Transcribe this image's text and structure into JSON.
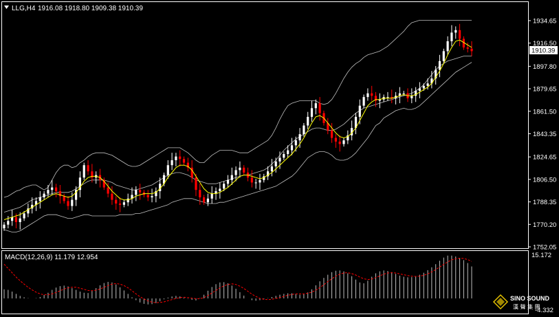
{
  "header": {
    "arrow_icon": "triangle-down-icon",
    "symbol": "LLG,H4",
    "ohlc": "1916.08 1918.80 1909.38 1910.39"
  },
  "price_axis": {
    "ticks": [
      "1934.65",
      "1916.50",
      "1897.80",
      "1879.65",
      "1861.50",
      "1843.35",
      "1824.65",
      "1806.50",
      "1788.35",
      "1770.20",
      "1752.05"
    ],
    "current_price_label": "1910.39"
  },
  "macd_panel": {
    "title": "MACD(12,26,9) 11.179 12.954",
    "top_label": "15.172",
    "bottom_label": "-4.332"
  },
  "watermark": {
    "brand": "SINO SOUND",
    "sub": "漢 聲 集 團",
    "icon": "diamond-logo-icon"
  },
  "colors": {
    "background": "#000000",
    "bull_candle": "#ffffff",
    "bear_candle": "#ff0000",
    "bollinger": "#c0c0c0",
    "ma_line": "#ffff00",
    "macd_hist": "#c0c0c0",
    "macd_signal": "#ff0000"
  },
  "chart_data": [
    {
      "type": "candlestick",
      "title": "LLG,H4",
      "ylim": [
        1752.05,
        1934.65
      ],
      "ticks": [
        1934.65,
        1916.5,
        1897.8,
        1879.65,
        1861.5,
        1843.35,
        1824.65,
        1806.5,
        1788.35,
        1770.2,
        1752.05
      ],
      "last_close": 1910.39,
      "close": [
        1770,
        1773,
        1776,
        1772,
        1775,
        1779,
        1783,
        1786,
        1789,
        1792,
        1795,
        1798,
        1800,
        1797,
        1793,
        1789,
        1785,
        1790,
        1798,
        1808,
        1818,
        1813,
        1808,
        1810,
        1806,
        1800,
        1795,
        1790,
        1787,
        1786,
        1788,
        1791,
        1794,
        1798,
        1796,
        1794,
        1792,
        1793,
        1797,
        1803,
        1810,
        1818,
        1822,
        1825,
        1823,
        1820,
        1816,
        1808,
        1798,
        1792,
        1788,
        1791,
        1795,
        1797,
        1799,
        1803,
        1806,
        1810,
        1814,
        1816,
        1812,
        1808,
        1804,
        1804,
        1806,
        1809,
        1813,
        1817,
        1821,
        1824,
        1827,
        1830,
        1834,
        1838,
        1843,
        1850,
        1857,
        1864,
        1868,
        1860,
        1852,
        1846,
        1840,
        1837,
        1835,
        1838,
        1842,
        1848,
        1857,
        1866,
        1873,
        1876,
        1874,
        1870,
        1871,
        1873,
        1873,
        1872,
        1874,
        1876,
        1876,
        1872,
        1874,
        1878,
        1880,
        1882,
        1884,
        1888,
        1895,
        1902,
        1910,
        1918,
        1925,
        1927,
        1920,
        1913,
        1912,
        1910
      ],
      "bollinger_upper": [
        1792,
        1793,
        1795,
        1797,
        1798,
        1800,
        1801,
        1802,
        1802,
        1800,
        1798,
        1800,
        1806,
        1812,
        1816,
        1818,
        1818,
        1816,
        1817,
        1820,
        1822,
        1825,
        1827,
        1828,
        1828,
        1828,
        1827,
        1826,
        1824,
        1822,
        1820,
        1818,
        1817,
        1817,
        1818,
        1820,
        1822,
        1824,
        1826,
        1828,
        1830,
        1832,
        1832,
        1832,
        1832,
        1830,
        1828,
        1825,
        1822,
        1820,
        1820,
        1823,
        1826,
        1828,
        1830,
        1830,
        1830,
        1830,
        1829,
        1828,
        1828,
        1828,
        1830,
        1832,
        1834,
        1836,
        1838,
        1842,
        1848,
        1855,
        1861,
        1866,
        1868,
        1869,
        1870,
        1870,
        1870,
        1870,
        1870,
        1868,
        1867,
        1868,
        1871,
        1876,
        1882,
        1888,
        1893,
        1897,
        1900,
        1902,
        1905,
        1907,
        1908,
        1909,
        1910,
        1912,
        1914,
        1917,
        1920,
        1923,
        1926,
        1930,
        1933,
        1934,
        1935,
        1935,
        1935,
        1935,
        1935,
        1935,
        1935,
        1935,
        1935,
        1935,
        1935,
        1935,
        1935,
        1935
      ],
      "bollinger_middle": [
        1780,
        1781,
        1782,
        1783,
        1784,
        1786,
        1788,
        1790,
        1791,
        1792,
        1793,
        1794,
        1795,
        1796,
        1796,
        1796,
        1796,
        1797,
        1799,
        1801,
        1803,
        1805,
        1806,
        1806,
        1806,
        1806,
        1805,
        1804,
        1802,
        1801,
        1800,
        1799,
        1798,
        1798,
        1799,
        1800,
        1801,
        1802,
        1804,
        1806,
        1808,
        1810,
        1811,
        1812,
        1812,
        1811,
        1810,
        1808,
        1806,
        1805,
        1804,
        1803,
        1803,
        1803,
        1804,
        1805,
        1806,
        1807,
        1808,
        1809,
        1810,
        1810,
        1811,
        1812,
        1813,
        1814,
        1816,
        1819,
        1822,
        1826,
        1830,
        1833,
        1836,
        1839,
        1841,
        1843,
        1845,
        1847,
        1848,
        1848,
        1847,
        1846,
        1846,
        1847,
        1849,
        1851,
        1854,
        1857,
        1860,
        1862,
        1864,
        1865,
        1866,
        1867,
        1868,
        1869,
        1870,
        1871,
        1872,
        1873,
        1874,
        1875,
        1876,
        1878,
        1880,
        1883,
        1887,
        1891,
        1895,
        1898,
        1900,
        1902,
        1903,
        1904,
        1905,
        1906,
        1906,
        1906
      ],
      "bollinger_lower": [
        1766,
        1765,
        1764,
        1764,
        1765,
        1767,
        1769,
        1771,
        1773,
        1775,
        1777,
        1778,
        1778,
        1778,
        1777,
        1776,
        1775,
        1775,
        1776,
        1777,
        1778,
        1778,
        1777,
        1777,
        1777,
        1777,
        1777,
        1777,
        1777,
        1778,
        1778,
        1778,
        1778,
        1779,
        1779,
        1780,
        1781,
        1782,
        1783,
        1784,
        1785,
        1786,
        1788,
        1789,
        1790,
        1791,
        1791,
        1791,
        1790,
        1789,
        1788,
        1787,
        1787,
        1787,
        1788,
        1788,
        1789,
        1790,
        1791,
        1792,
        1793,
        1794,
        1795,
        1796,
        1797,
        1798,
        1799,
        1800,
        1801,
        1803,
        1805,
        1807,
        1809,
        1812,
        1816,
        1820,
        1824,
        1826,
        1828,
        1829,
        1829,
        1828,
        1826,
        1823,
        1822,
        1822,
        1823,
        1825,
        1828,
        1832,
        1836,
        1840,
        1845,
        1850,
        1852,
        1856,
        1858,
        1860,
        1862,
        1863,
        1864,
        1863,
        1863,
        1864,
        1866,
        1869,
        1872,
        1875,
        1878,
        1881,
        1884,
        1887,
        1890,
        1893,
        1895,
        1897,
        1899,
        1901
      ],
      "ma": [
        1774,
        1775,
        1776,
        1777,
        1778,
        1780,
        1782,
        1784,
        1786,
        1788,
        1790,
        1792,
        1794,
        1795,
        1794,
        1793,
        1792,
        1793,
        1796,
        1800,
        1805,
        1808,
        1809,
        1809,
        1808,
        1805,
        1801,
        1797,
        1794,
        1791,
        1790,
        1790,
        1791,
        1793,
        1794,
        1795,
        1795,
        1795,
        1796,
        1799,
        1803,
        1808,
        1812,
        1816,
        1818,
        1818,
        1817,
        1814,
        1809,
        1804,
        1799,
        1796,
        1795,
        1795,
        1796,
        1798,
        1800,
        1803,
        1806,
        1809,
        1810,
        1810,
        1809,
        1808,
        1807,
        1808,
        1810,
        1812,
        1815,
        1818,
        1821,
        1824,
        1827,
        1831,
        1835,
        1840,
        1846,
        1852,
        1857,
        1858,
        1856,
        1852,
        1848,
        1844,
        1841,
        1840,
        1841,
        1844,
        1848,
        1854,
        1860,
        1866,
        1869,
        1871,
        1871,
        1872,
        1872,
        1872,
        1873,
        1874,
        1875,
        1874,
        1874,
        1875,
        1877,
        1879,
        1881,
        1884,
        1889,
        1894,
        1900,
        1907,
        1913,
        1918,
        1919,
        1917,
        1915,
        1913
      ]
    },
    {
      "type": "bar",
      "title": "MACD(12,26,9)",
      "series": [
        {
          "name": "MACD",
          "values": [
            3.2,
            3.0,
            2.4,
            1.6,
            0.9,
            0.4,
            0.1,
            0.0,
            0.1,
            0.5,
            1.2,
            2.0,
            3.0,
            3.8,
            4.3,
            4.5,
            4.2,
            3.6,
            3.0,
            2.4,
            2.0,
            1.9,
            2.6,
            3.6,
            4.6,
            5.4,
            5.8,
            5.6,
            4.9,
            3.9,
            2.8,
            1.6,
            0.4,
            -0.6,
            -1.4,
            -1.9,
            -2.1,
            -2.0,
            -1.6,
            -1.0,
            -0.3,
            0.3,
            0.7,
            0.9,
            0.7,
            0.3,
            -0.1,
            -0.5,
            -0.7,
            0.1,
            1.3,
            2.7,
            4.0,
            5.0,
            5.6,
            5.7,
            5.3,
            4.5,
            3.4,
            2.2,
            1.0,
            0.0,
            -0.6,
            -0.8,
            -0.6,
            -0.3,
            0.1,
            0.5,
            0.9,
            1.3,
            1.6,
            1.8,
            1.8,
            1.6,
            1.3,
            1.5,
            2.1,
            3.2,
            4.6,
            6.0,
            7.2,
            8.3,
            9.2,
            9.7,
            9.8,
            9.5,
            8.8,
            7.8,
            6.6,
            5.6,
            5.3,
            6.2,
            7.6,
            8.8,
            9.5,
            9.8,
            9.6,
            9.2,
            8.6,
            8.0,
            7.6,
            7.4,
            7.5,
            7.8,
            8.3,
            9.0,
            9.9,
            10.9,
            12.0,
            13.2,
            14.3,
            15.0,
            15.0,
            14.7,
            14.2,
            13.4,
            12.4,
            11.2
          ]
        },
        {
          "name": "Signal",
          "values": [
            12.0,
            10.5,
            9.0,
            7.5,
            6.2,
            5.0,
            3.9,
            3.0,
            2.2,
            1.6,
            1.3,
            1.3,
            1.6,
            2.1,
            2.7,
            3.3,
            3.7,
            3.9,
            3.9,
            3.6,
            3.2,
            2.8,
            2.7,
            2.9,
            3.3,
            3.9,
            4.5,
            5.0,
            5.2,
            5.0,
            4.5,
            3.7,
            2.7,
            1.6,
            0.6,
            -0.2,
            -0.9,
            -1.3,
            -1.5,
            -1.4,
            -1.2,
            -0.8,
            -0.4,
            0.0,
            0.3,
            0.4,
            0.3,
            0.1,
            -0.1,
            -0.1,
            0.3,
            1.0,
            1.9,
            2.8,
            3.7,
            4.4,
            4.9,
            5.1,
            4.9,
            4.3,
            3.5,
            2.5,
            1.5,
            0.7,
            0.0,
            -0.3,
            -0.4,
            -0.3,
            0.0,
            0.3,
            0.7,
            1.1,
            1.4,
            1.6,
            1.6,
            1.6,
            1.8,
            2.2,
            2.9,
            3.8,
            4.8,
            5.9,
            6.9,
            7.8,
            8.5,
            8.9,
            9.0,
            8.7,
            8.2,
            7.5,
            6.9,
            6.6,
            6.8,
            7.3,
            7.9,
            8.5,
            8.9,
            9.0,
            8.9,
            8.6,
            8.3,
            8.0,
            7.8,
            7.7,
            7.8,
            8.1,
            8.6,
            9.3,
            10.1,
            11.0,
            11.9,
            12.8,
            13.5,
            13.9,
            14.1,
            14.0,
            13.6,
            12.954
          ]
        }
      ],
      "ylim": [
        -4.332,
        15.172
      ]
    }
  ]
}
